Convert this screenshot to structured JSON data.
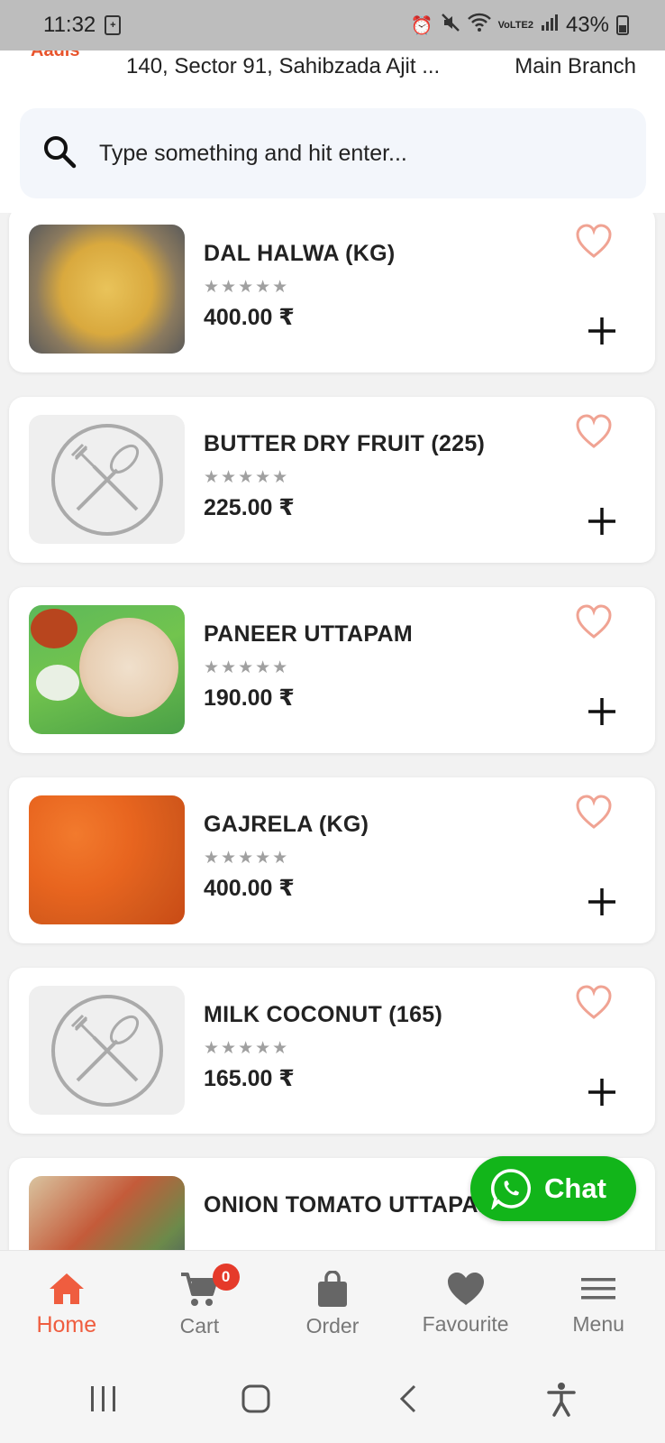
{
  "status_bar": {
    "time": "11:32",
    "battery": "43%",
    "network": "VoLTE2"
  },
  "header": {
    "logo_text": "Aadis",
    "address": "140, Sector 91, Sahibzada Ajit ...",
    "branch": "Main Branch"
  },
  "search": {
    "placeholder": "Type something and hit enter..."
  },
  "products": [
    {
      "name": "DAL HALWA (KG)",
      "rating": 0,
      "price": "400.00 ₹",
      "image": "dal-halwa-photo"
    },
    {
      "name": "BUTTER DRY FRUIT (225)",
      "rating": 0,
      "price": "225.00 ₹",
      "image": "placeholder-icon"
    },
    {
      "name": "PANEER UTTAPAM",
      "rating": 0,
      "price": "190.00 ₹",
      "image": "paneer-uttapam-photo"
    },
    {
      "name": "GAJRELA (KG)",
      "rating": 0,
      "price": "400.00 ₹",
      "image": "gajrela-photo"
    },
    {
      "name": "MILK COCONUT (165)",
      "rating": 0,
      "price": "165.00 ₹",
      "image": "placeholder-icon"
    },
    {
      "name": "ONION TOMATO UTTAPAM",
      "rating": 0,
      "price": "",
      "image": "onion-tomato-uttapam-photo"
    }
  ],
  "stars_text": "★★★★★",
  "chat": {
    "label": "Chat"
  },
  "bottom_nav": {
    "items": [
      {
        "label": "Home",
        "icon": "home-icon",
        "active": true
      },
      {
        "label": "Cart",
        "icon": "cart-icon",
        "badge": "0"
      },
      {
        "label": "Order",
        "icon": "bag-icon"
      },
      {
        "label": "Favourite",
        "icon": "heart-icon"
      },
      {
        "label": "Menu",
        "icon": "menu-icon"
      }
    ]
  },
  "colors": {
    "accent": "#ef5d3f",
    "chat_green": "#12b51a",
    "heart": "#f0a393"
  }
}
